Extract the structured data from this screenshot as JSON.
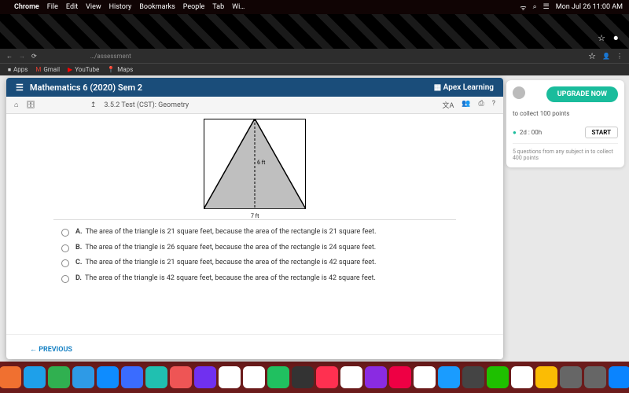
{
  "menubar": {
    "apple": "",
    "app": "Chrome",
    "items": [
      "File",
      "Edit",
      "View",
      "History",
      "Bookmarks",
      "People",
      "Tab",
      "Wi…"
    ],
    "clock": "Mon Jul 26  11:00 AM"
  },
  "browser": {
    "url_fragment": "…/assessment",
    "bookmarks": [
      {
        "icon": "⏹",
        "label": "Apps"
      },
      {
        "icon": "M",
        "label": "Gmail"
      },
      {
        "icon": "▶",
        "label": "YouTube"
      },
      {
        "icon": "📍",
        "label": "Maps"
      }
    ]
  },
  "course": {
    "title": "Mathematics 6 (2020) Sem 2",
    "brand": "Apex Learning"
  },
  "test_bar": {
    "breadcrumb": "3.5.2  Test (CST):  Geometry"
  },
  "figure": {
    "height_label": "6 ft",
    "base_label": "7 ft"
  },
  "choices": [
    {
      "letter": "A.",
      "text": "The area of the triangle is 21 square feet, because the area of the rectangle is 21 square feet."
    },
    {
      "letter": "B.",
      "text": "The area of the triangle is 26 square feet, because the area of the rectangle is 24 square feet."
    },
    {
      "letter": "C.",
      "text": "The area of the triangle is 21 square feet, because the area of the rectangle is 42 square feet."
    },
    {
      "letter": "D.",
      "text": "The area of the triangle is 42 square feet, because the area of the rectangle is 42 square feet."
    }
  ],
  "nav": {
    "previous": "← PREVIOUS"
  },
  "side": {
    "upgrade": "UPGRADE NOW",
    "goal1": "to collect 100 points",
    "timer": "2d : 00h",
    "start": "START",
    "goal2": "5 questions from any subject in to collect 400 points"
  },
  "dock_colors": [
    "#2e6ff0",
    "#f07030",
    "#1ea0ea",
    "#30b050",
    "#2e9ae6",
    "#0e8cff",
    "#3a6cff",
    "#20c0b0",
    "#e55",
    "#7030f0",
    "#fff",
    "#fff",
    "#20c060",
    "#333",
    "#ff3050",
    "#fff",
    "#8a2be2",
    "#e04",
    "#fff",
    "#1a9cff",
    "#444",
    "#1ec000",
    "#fff",
    "#fbbc04",
    "#666",
    "#666",
    "#0a84ff",
    "#666"
  ]
}
